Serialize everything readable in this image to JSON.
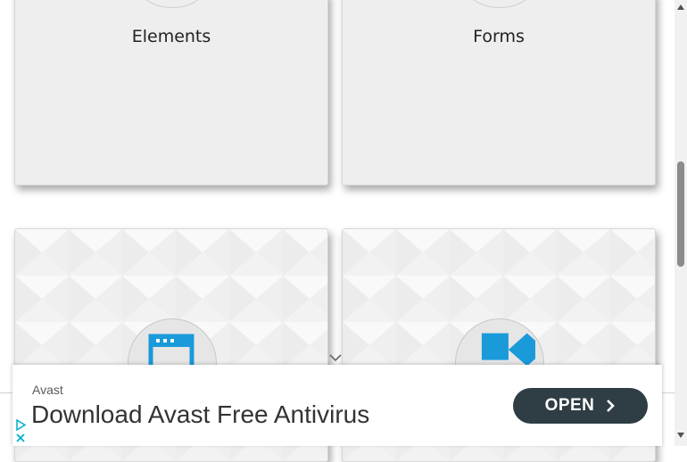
{
  "cards": [
    {
      "title": "Elements",
      "icon": "elements-icon"
    },
    {
      "title": "Forms",
      "icon": "forms-icon"
    },
    {
      "title": "",
      "icon": "browser-window-icon"
    },
    {
      "title": "",
      "icon": "widgets-icon"
    }
  ],
  "ad": {
    "brand": "Avast",
    "headline": "Download Avast Free Antivirus",
    "cta_label": "OPEN"
  },
  "colors": {
    "card_bg": "#eeeeee",
    "icon_blue": "#1a9ad9",
    "cta_bg": "#2f3d44",
    "scroll_thumb": "#8b8b8b",
    "adchoices_blue": "#00aecd"
  },
  "scroll": {
    "position_fraction": 0.36
  }
}
